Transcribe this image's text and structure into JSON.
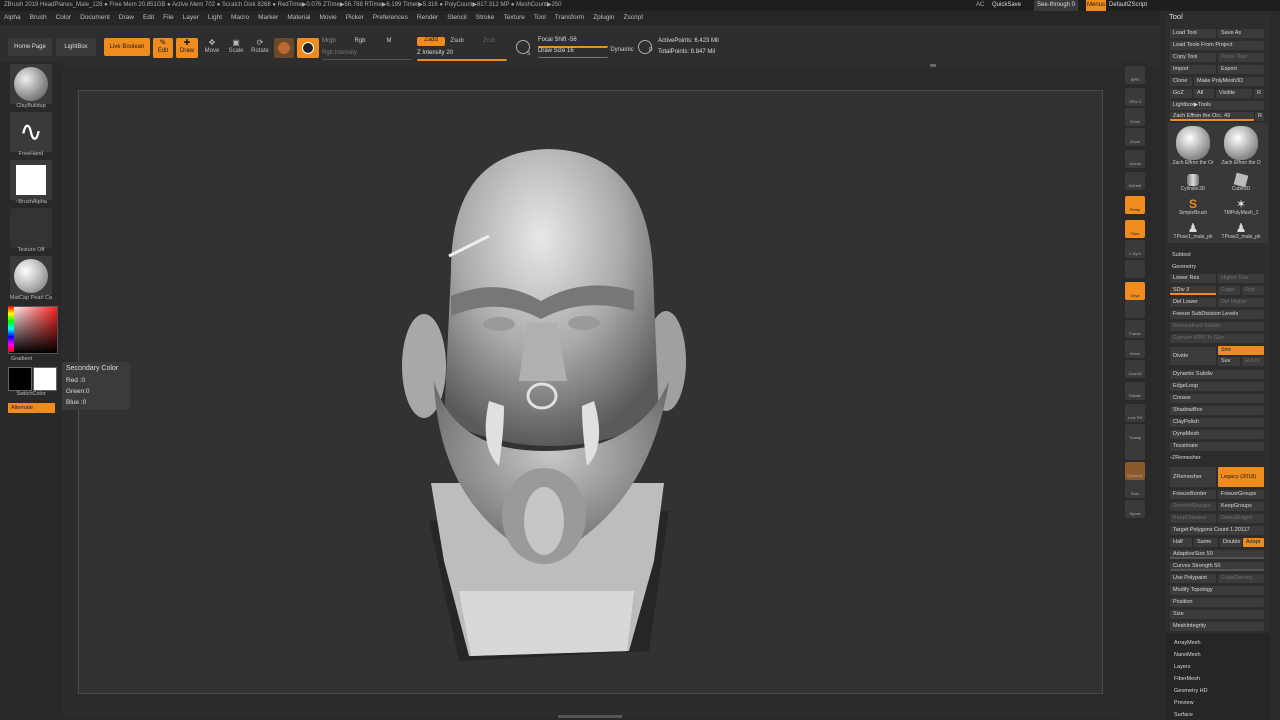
{
  "titlebar": {
    "text": "ZBrush 2019   HeadPlanes_Male_128   ● Free Mem 20.851GB ● Active Mem 702 ● Scratch Disk 8268 ● RedTime▶0.076 ZTime▶56.788 RTime▶6.199 Timer▶5.316 ● PolyCount▶817.312 MP ● MeshCount▶250",
    "ac": "AC",
    "quicksave": "QuickSave",
    "seethrough": "See-through   0",
    "menus": "Menus",
    "default_script": "DefaultZScript"
  },
  "menubar": [
    "Alpha",
    "Brush",
    "Color",
    "Document",
    "Draw",
    "Edit",
    "File",
    "Layer",
    "Light",
    "Macro",
    "Marker",
    "Material",
    "Movie",
    "Picker",
    "Preferences",
    "Render",
    "Stencil",
    "Stroke",
    "Texture",
    "Tool",
    "Transform",
    "Zplugin",
    "Zscript"
  ],
  "toolbar": {
    "home_page": "Home Page",
    "lightbox": "LightBox",
    "live_boolean": "Live Boolean",
    "edit": "Edit",
    "draw": "Draw",
    "move": "Move",
    "scale": "Scale",
    "rotate": "Rotate",
    "mrgb": "Mrgb",
    "rgb": "Rgb",
    "m": "M",
    "zadd": "Zadd",
    "zsub": "Zsub",
    "zcut": "Zcut",
    "rgb_intensity": "Rgb Intensity",
    "z_intensity": "Z Intensity 20",
    "focal_shift": "Focal Shift -56",
    "draw_size": "Draw Size 16",
    "dynamic": "Dynamic",
    "active_points": "ActivePoints: 6.423 Mil",
    "total_points": "TotalPoints: 8.847 Mil",
    "s_label": "S",
    "d_label": "D"
  },
  "leftshelf": {
    "brush": "ClayBuildup",
    "stroke": "FreeHand",
    "alpha": "~BrushAlpha",
    "texture": "Texture Off",
    "material": "MatCap Pearl Ca",
    "gradient": "Gradient",
    "switch_color": "SwitchColor",
    "alternate": "Alternate"
  },
  "tooltip": {
    "title": "Secondary Color",
    "red": "Red :0",
    "green": "Green:0",
    "blue": "Blue :0"
  },
  "rightshelf": [
    "BPR",
    "SPix 3",
    "Scroll",
    "Zoom",
    "Actual",
    "AAHalf",
    "Persp",
    "Floor",
    "L.Sym",
    "",
    "Gxyz",
    "",
    "Frame",
    "Move",
    "ZoomD",
    "Rotate",
    "Line Fill PolyF",
    "Transp",
    "",
    "Dynamic",
    "Solo",
    "Xpose"
  ],
  "palette": {
    "title": "Tool",
    "load_tool": "Load Tool",
    "save_as": "Save As",
    "load_from_project": "Load Tools From Project",
    "copy_tool": "Copy Tool",
    "paste_tool": "Paste Tool",
    "import": "Import",
    "export": "Export",
    "clone": "Clone",
    "make_polymesh": "Make PolyMesh3D",
    "goz": "GoZ",
    "all": "All",
    "visible": "Visible",
    "r": "R",
    "lightbox_tools": "Lightbox▶Tools",
    "current_tool": "Zach Effron the Orc. 49",
    "thumbs": [
      "Zach Effron the Or",
      "Zach Effron the O",
      "Cylinder3D",
      "Cube3D",
      "SimpleBrush",
      "TMPolyMesh_1",
      "TPose1_male_pk",
      "TPose2_male_pk"
    ],
    "subtool": "Subtool",
    "geometry": "Geometry",
    "lower_res": "Lower Res",
    "higher_res": "Higher Res",
    "sdiv": "SDiv 3",
    "cage": "Cage",
    "rstr": "Rstr",
    "del_lower": "Del Lower",
    "del_higher": "Del Higher",
    "freeze_subdiv": "Freeze SubDivision Levels",
    "reconstruct": "Reconstruct Subdiv",
    "convert_bpr": "Convert BPR To Geo",
    "divide": "Divide",
    "smt": "Smt",
    "suv": "Suv",
    "reuv": "ReUV",
    "dynamic_subdiv": "Dynamic Subdiv",
    "edgeloop": "EdgeLoop",
    "crease": "Crease",
    "shadowbox": "ShadowBox",
    "claypolish": "ClayPolish",
    "dynamesh": "DynaMesh",
    "tessimate": "Tessimate",
    "zremesher_header": "ZRemesher",
    "zremesher": "ZRemesher",
    "legacy": "Legacy (2018)",
    "freeze_border": "FreezeBorder",
    "freeze_groups": "FreezeGroups",
    "smooth_groups": "SmoothGroups",
    "keep_groups": "KeepGroups",
    "keep_creases": "KeepCreases",
    "detect_edges": "DetectEdges",
    "target_polygons": "Target Polygons Count 1.20117",
    "half": "Half",
    "same": "Same",
    "double": "Double",
    "adapt": "Adapt",
    "adaptive_size": "AdaptiveSize 50",
    "curves_strength": "Curves Strength 50",
    "use_polypaint": "Use Polypaint",
    "color_density": "ColorDensity",
    "modify_topology": "Modify Topology",
    "position": "Position",
    "size": "Size",
    "mesh_integrity": "MeshIntegrity",
    "sections": [
      "ArrayMesh",
      "NanoMesh",
      "Layers",
      "FiberMesh",
      "Geometry HD",
      "Preview",
      "Surface"
    ]
  },
  "colors": {
    "accent": "#f08c1e",
    "primary_color": "#000000",
    "secondary_color": "#ffffff"
  }
}
